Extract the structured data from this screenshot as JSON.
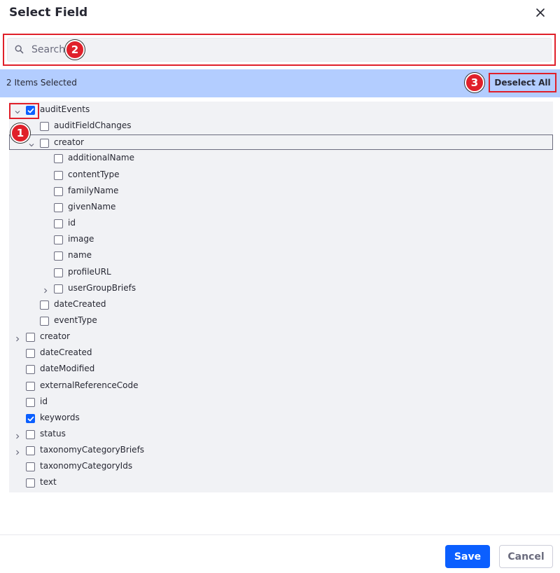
{
  "dialog": {
    "title": "Select Field",
    "close_icon": "close-icon"
  },
  "search": {
    "placeholder": "Search",
    "value": "",
    "icon": "search-icon"
  },
  "selection": {
    "count": "2",
    "count_label": "Items Selected",
    "deselect_all": "Deselect All"
  },
  "callouts": [
    "1",
    "2",
    "3"
  ],
  "tree": [
    {
      "label": "auditEvents",
      "depth": 0,
      "expander": "expanded",
      "checked": true
    },
    {
      "label": "auditFieldChanges",
      "depth": 1,
      "expander": "none",
      "checked": false
    },
    {
      "label": "creator",
      "depth": 1,
      "expander": "expanded",
      "checked": false,
      "focused": true
    },
    {
      "label": "additionalName",
      "depth": 2,
      "expander": "none",
      "checked": false
    },
    {
      "label": "contentType",
      "depth": 2,
      "expander": "none",
      "checked": false
    },
    {
      "label": "familyName",
      "depth": 2,
      "expander": "none",
      "checked": false
    },
    {
      "label": "givenName",
      "depth": 2,
      "expander": "none",
      "checked": false
    },
    {
      "label": "id",
      "depth": 2,
      "expander": "none",
      "checked": false
    },
    {
      "label": "image",
      "depth": 2,
      "expander": "none",
      "checked": false
    },
    {
      "label": "name",
      "depth": 2,
      "expander": "none",
      "checked": false
    },
    {
      "label": "profileURL",
      "depth": 2,
      "expander": "none",
      "checked": false
    },
    {
      "label": "userGroupBriefs",
      "depth": 2,
      "expander": "collapsed",
      "checked": false
    },
    {
      "label": "dateCreated",
      "depth": 1,
      "expander": "none",
      "checked": false
    },
    {
      "label": "eventType",
      "depth": 1,
      "expander": "none",
      "checked": false
    },
    {
      "label": "creator",
      "depth": 0,
      "expander": "collapsed",
      "checked": false
    },
    {
      "label": "dateCreated",
      "depth": 0,
      "expander": "none",
      "checked": false
    },
    {
      "label": "dateModified",
      "depth": 0,
      "expander": "none",
      "checked": false
    },
    {
      "label": "externalReferenceCode",
      "depth": 0,
      "expander": "none",
      "checked": false
    },
    {
      "label": "id",
      "depth": 0,
      "expander": "none",
      "checked": false
    },
    {
      "label": "keywords",
      "depth": 0,
      "expander": "none",
      "checked": true
    },
    {
      "label": "status",
      "depth": 0,
      "expander": "collapsed",
      "checked": false
    },
    {
      "label": "taxonomyCategoryBriefs",
      "depth": 0,
      "expander": "collapsed",
      "checked": false
    },
    {
      "label": "taxonomyCategoryIds",
      "depth": 0,
      "expander": "none",
      "checked": false
    },
    {
      "label": "text",
      "depth": 0,
      "expander": "none",
      "checked": false
    }
  ],
  "footer": {
    "save": "Save",
    "cancel": "Cancel"
  },
  "colors": {
    "accent": "#0b5fff",
    "selection_bar": "#b3cdff",
    "annotation": "#e0202a",
    "tree_bg": "#f1f2f5"
  }
}
